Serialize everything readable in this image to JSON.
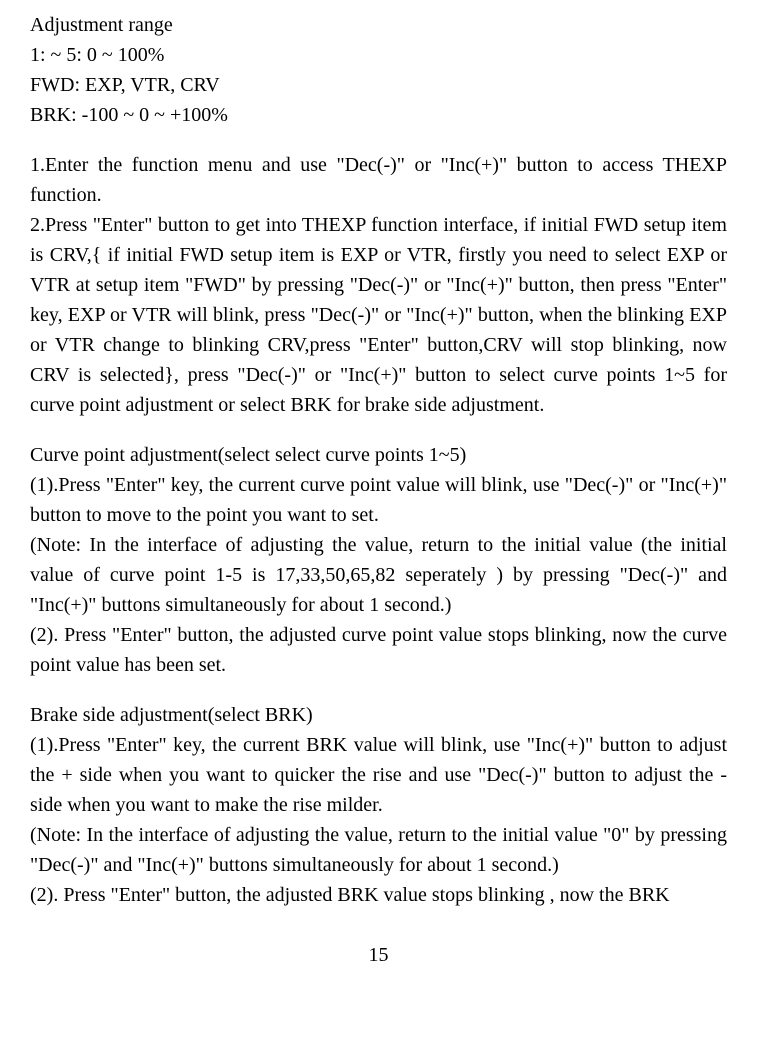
{
  "spec": {
    "line1": "Adjustment   range",
    "line2": "1: ~ 5: 0 ~ 100%",
    "line3": "FWD: EXP, VTR, CRV",
    "line4": "BRK: -100 ~ 0 ~ +100%"
  },
  "step1": "1.Enter the function menu and use   \"Dec(-)\" or \"Inc(+)\" button to access THEXP function.",
  "step2": "2.Press \"Enter\" button to get into THEXP function interface, if initial FWD setup item is CRV,{ if initial FWD setup item is EXP or VTR, firstly you need to select EXP or VTR at setup item \"FWD\" by pressing \"Dec(-)\" or \"Inc(+)\" button, then press \"Enter\" key, EXP   or VTR will blink, press \"Dec(-)\" or \"Inc(+)\" button, when the blinking EXP or VTR change to blinking CRV,press \"Enter\" button,CRV will stop blinking, now CRV is selected}, press \"Dec(-)\" or \"Inc(+)\" button to select curve points 1~5 for curve point adjustment or select BRK for brake side adjustment.",
  "curve": {
    "title": "Curve point adjustment(select select curve points 1~5)",
    "p1": "(1).Press \"Enter\" key, the current curve point value will blink, use \"Dec(-)\" or \"Inc(+)\" button to move to the point you want to set.",
    "note": "(Note: In the interface of adjusting the value, return to the initial value (the initial value of curve point 1-5 is 17,33,50,65,82 seperately ) by pressing \"Dec(-)\" and \"Inc(+)\" buttons simultaneously for about 1 second.)",
    "p2": "(2). Press \"Enter\" button, the adjusted curve point value stops blinking, now the curve point value has been set."
  },
  "brake": {
    "title": "Brake side adjustment(select BRK)",
    "p1": "(1).Press \"Enter\" key, the current BRK value will blink, use   \"Inc(+)\" button to adjust the + side when you want to quicker the rise and use \"Dec(-)\" button to adjust the - side when you want to make the rise milder.",
    "note": "(Note: In the interface of adjusting the value, return to the initial value \"0\" by pressing \"Dec(-)\" and \"Inc(+)\" buttons simultaneously for about 1 second.)",
    "p2": "(2). Press   \"Enter\" button, the adjusted BRK value stops blinking , now the BRK"
  },
  "pageNumber": "15"
}
